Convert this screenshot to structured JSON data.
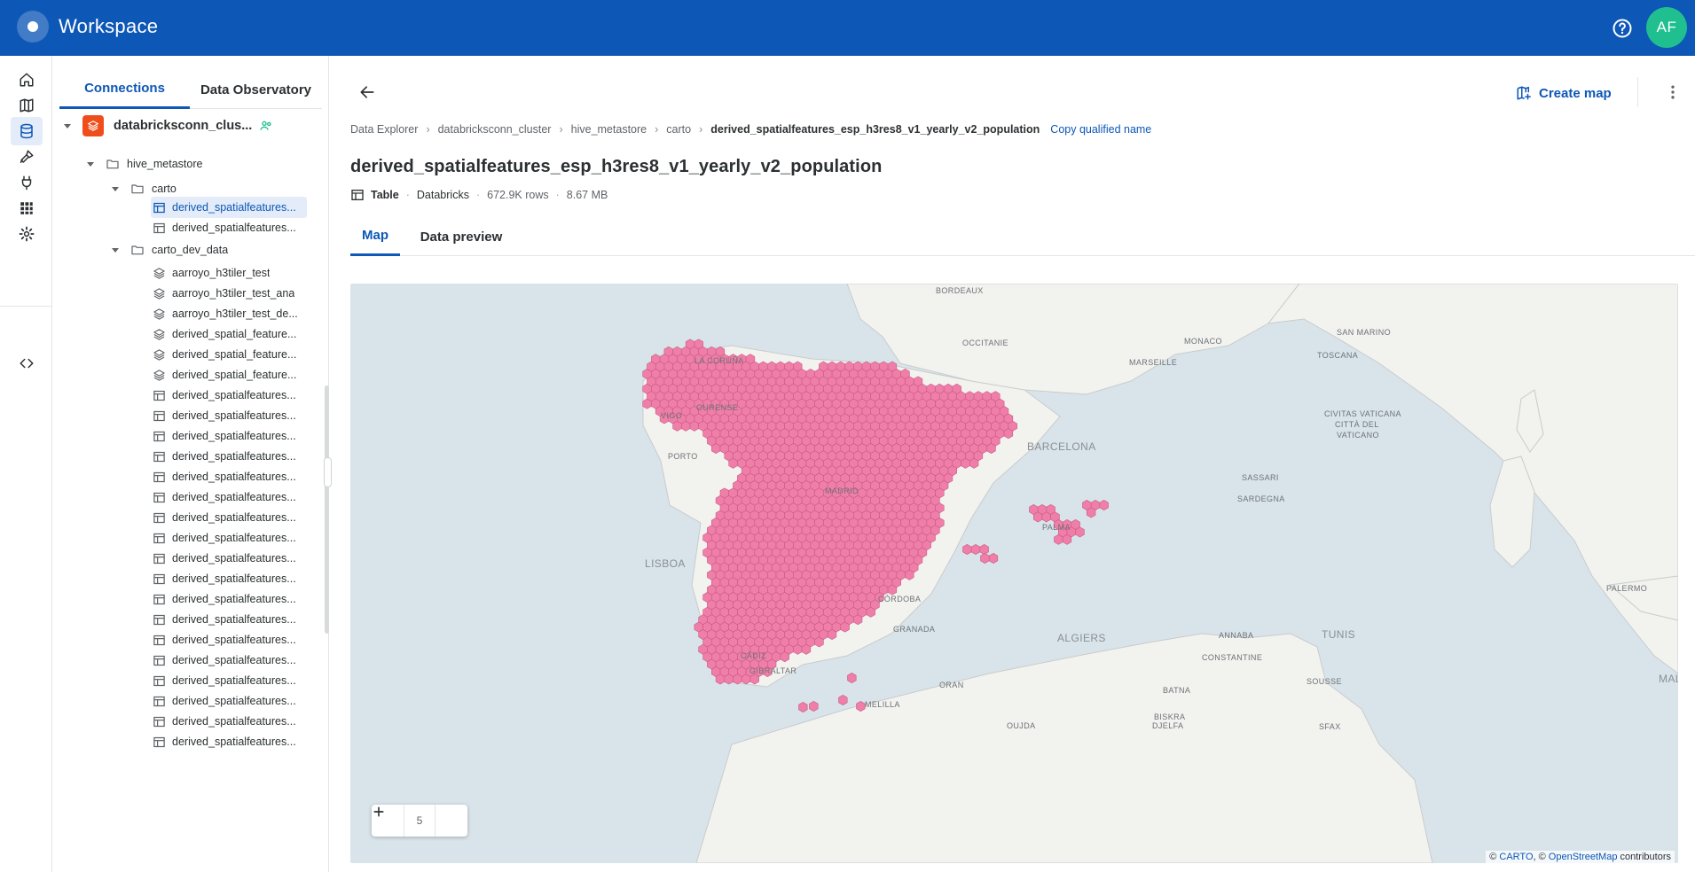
{
  "header": {
    "app_title": "Workspace",
    "avatar_initials": "AF",
    "help_icon": "help-circle-icon",
    "brand_color": "#0d57b7"
  },
  "rail": {
    "items": [
      {
        "icon": "home-icon"
      },
      {
        "icon": "maps-icon"
      },
      {
        "icon": "data-explorer-icon",
        "active": true
      },
      {
        "icon": "workflows-icon"
      },
      {
        "icon": "connections-icon"
      },
      {
        "icon": "apps-icon"
      },
      {
        "icon": "settings-icon"
      },
      {
        "icon": "developers-icon"
      }
    ]
  },
  "sidebar": {
    "tabs": [
      "Connections",
      "Data Observatory"
    ],
    "connection": {
      "name": "databricksconn_clus..."
    },
    "catalog": {
      "name": "hive_metastore"
    },
    "schemas": [
      {
        "name": "carto",
        "tables": [
          {
            "name": "derived_spatialfeatures...",
            "selected": true
          },
          {
            "name": "derived_spatialfeatures..."
          }
        ]
      },
      {
        "name": "carto_dev_data",
        "tables": [
          {
            "name": "aarroyo_h3tiler_test",
            "kind": "tileset"
          },
          {
            "name": "aarroyo_h3tiler_test_ana",
            "kind": "tileset"
          },
          {
            "name": "aarroyo_h3tiler_test_de...",
            "kind": "tileset"
          },
          {
            "name": "derived_spatial_feature...",
            "kind": "tileset"
          },
          {
            "name": "derived_spatial_feature...",
            "kind": "tileset"
          },
          {
            "name": "derived_spatial_feature...",
            "kind": "tileset"
          },
          {
            "name": "derived_spatialfeatures...",
            "kind": "table"
          },
          {
            "name": "derived_spatialfeatures...",
            "kind": "table"
          },
          {
            "name": "derived_spatialfeatures...",
            "kind": "table"
          },
          {
            "name": "derived_spatialfeatures...",
            "kind": "table"
          },
          {
            "name": "derived_spatialfeatures...",
            "kind": "table"
          },
          {
            "name": "derived_spatialfeatures...",
            "kind": "table"
          },
          {
            "name": "derived_spatialfeatures...",
            "kind": "table"
          },
          {
            "name": "derived_spatialfeatures...",
            "kind": "table"
          },
          {
            "name": "derived_spatialfeatures...",
            "kind": "table"
          },
          {
            "name": "derived_spatialfeatures...",
            "kind": "table"
          },
          {
            "name": "derived_spatialfeatures...",
            "kind": "table"
          },
          {
            "name": "derived_spatialfeatures...",
            "kind": "table"
          },
          {
            "name": "derived_spatialfeatures...",
            "kind": "table"
          },
          {
            "name": "derived_spatialfeatures...",
            "kind": "table"
          },
          {
            "name": "derived_spatialfeatures...",
            "kind": "table"
          },
          {
            "name": "derived_spatialfeatures...",
            "kind": "table"
          },
          {
            "name": "derived_spatialfeatures...",
            "kind": "table"
          },
          {
            "name": "derived_spatialfeatures...",
            "kind": "table"
          }
        ]
      }
    ]
  },
  "main": {
    "create_map_label": "Create map",
    "breadcrumb": [
      "Data Explorer",
      "databricksconn_cluster",
      "hive_metastore",
      "carto"
    ],
    "breadcrumb_current": "derived_spatialfeatures_esp_h3res8_v1_yearly_v2_population",
    "copy_label": "Copy qualified name",
    "title": "derived_spatialfeatures_esp_h3res8_v1_yearly_v2_population",
    "meta": {
      "type": "Table",
      "provider": "Databricks",
      "rows": "672.9K rows",
      "size": "8.67 MB"
    },
    "tabs": [
      "Map",
      "Data preview"
    ],
    "map": {
      "zoom_level": "5",
      "layer_color": "#ef7fa8",
      "water_color": "#d8e4ea",
      "land_color": "#f2f2ef",
      "labels": [
        {
          "text": "BORDEAUX"
        },
        {
          "text": "OCCITANIE"
        },
        {
          "text": "MONACO"
        },
        {
          "text": "MARSEILLE"
        },
        {
          "text": "SAN MARINO"
        },
        {
          "text": "TOSCANA"
        },
        {
          "text": "CIVITAS VATICANA"
        },
        {
          "text": "CITTÀ DEL"
        },
        {
          "text": "VATICANO"
        },
        {
          "text": "BARCELONA"
        },
        {
          "text": "PORTO"
        },
        {
          "text": "SASSARI"
        },
        {
          "text": "SARDEGNA"
        },
        {
          "text": "LISBOA"
        },
        {
          "text": "PALERMO"
        },
        {
          "text": "ALGIERS"
        },
        {
          "text": "ANNABA"
        },
        {
          "text": "TUNIS"
        },
        {
          "text": "CONSTANTINE"
        },
        {
          "text": "ORAN"
        },
        {
          "text": "BATNA"
        },
        {
          "text": "SOUSSE"
        },
        {
          "text": "MALTA"
        },
        {
          "text": "MELILLA"
        },
        {
          "text": "OUJDA"
        },
        {
          "text": "DJELFA"
        },
        {
          "text": "BISKRA"
        },
        {
          "text": "SFAX"
        },
        {
          "text": "MADRID"
        },
        {
          "text": "GIBRALTAR"
        },
        {
          "text": "CÓRDOBA"
        },
        {
          "text": "GRANADA"
        },
        {
          "text": "PALMA"
        },
        {
          "text": "LA CORUÑA"
        },
        {
          "text": "OURENSE"
        },
        {
          "text": "VIGO"
        },
        {
          "text": "CÁDIZ"
        }
      ]
    },
    "attribution": {
      "prefix": "©",
      "carto": "CARTO",
      "mid": ", ©",
      "osm": "OpenStreetMap",
      "suffix": "contributors"
    }
  }
}
